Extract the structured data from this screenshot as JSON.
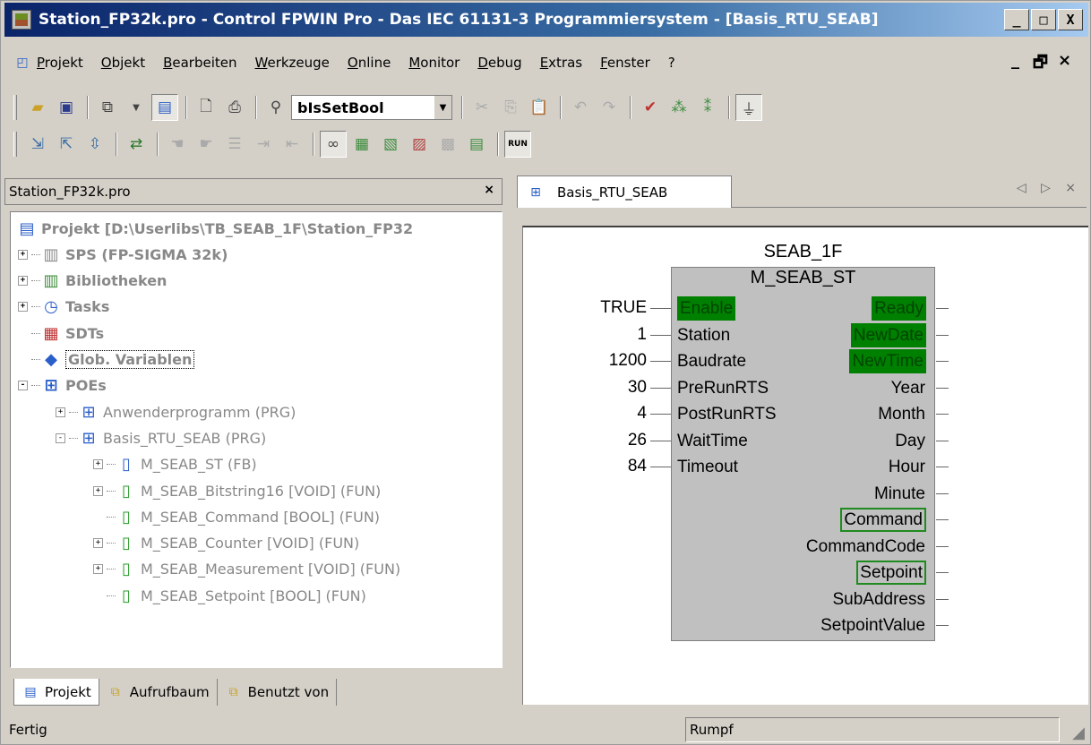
{
  "window": {
    "title": "Station_FP32k.pro - Control FPWIN Pro - Das IEC 61131-3 Programmiersystem - [Basis_RTU_SEAB]",
    "caption_buttons": [
      "_",
      "□",
      "X"
    ]
  },
  "menu": {
    "items": [
      "Projekt",
      "Objekt",
      "Bearbeiten",
      "Werkzeuge",
      "Online",
      "Monitor",
      "Debug",
      "Extras",
      "Fenster",
      "?"
    ],
    "mdi_buttons": [
      "_",
      "🗗",
      "×"
    ]
  },
  "toolbar": {
    "search_combo_value": "bIsSetBool",
    "run_label": "RUN"
  },
  "left_panel": {
    "header": "Station_FP32k.pro",
    "close": "×",
    "tree": [
      {
        "label": "Projekt [D:\\Userlibs\\TB_SEAB_1F\\Station_FP32",
        "level": 0,
        "bold": true,
        "expander": "",
        "icon": "project-icon"
      },
      {
        "label": "SPS (FP-SIGMA 32k)",
        "level": 1,
        "bold": true,
        "expander": "+",
        "icon": "plc-icon"
      },
      {
        "label": "Bibliotheken",
        "level": 1,
        "bold": true,
        "expander": "+",
        "icon": "library-icon"
      },
      {
        "label": "Tasks",
        "level": 1,
        "bold": true,
        "expander": "+",
        "icon": "tasks-icon"
      },
      {
        "label": "SDTs",
        "level": 1,
        "bold": true,
        "expander": "",
        "icon": "sdt-icon"
      },
      {
        "label": "Glob. Variablen",
        "level": 1,
        "bold": true,
        "expander": "",
        "icon": "global-vars-icon"
      },
      {
        "label": "POEs",
        "level": 1,
        "bold": true,
        "expander": "-",
        "icon": "poe-icon"
      },
      {
        "label": "Anwenderprogramm (PRG)",
        "level": 2,
        "bold": false,
        "expander": "+",
        "icon": "program-icon"
      },
      {
        "label": "Basis_RTU_SEAB (PRG)",
        "level": 2,
        "bold": false,
        "expander": "-",
        "icon": "program-icon"
      },
      {
        "label": "M_SEAB_ST (FB)",
        "level": 3,
        "bold": false,
        "expander": "+",
        "icon": "function-block-icon"
      },
      {
        "label": "M_SEAB_Bitstring16 [VOID] (FUN)",
        "level": 3,
        "bold": false,
        "expander": "+",
        "icon": "function-icon"
      },
      {
        "label": "M_SEAB_Command [BOOL] (FUN)",
        "level": 3,
        "bold": false,
        "expander": "",
        "icon": "function-icon"
      },
      {
        "label": "M_SEAB_Counter [VOID] (FUN)",
        "level": 3,
        "bold": false,
        "expander": "+",
        "icon": "function-icon"
      },
      {
        "label": "M_SEAB_Measurement [VOID] (FUN)",
        "level": 3,
        "bold": false,
        "expander": "+",
        "icon": "function-icon"
      },
      {
        "label": "M_SEAB_Setpoint [BOOL] (FUN)",
        "level": 3,
        "bold": false,
        "expander": "",
        "icon": "function-icon"
      }
    ],
    "bottom_tabs": [
      "Projekt",
      "Aufrufbaum",
      "Benutzt von"
    ]
  },
  "editor": {
    "tab_label": "Basis_RTU_SEAB",
    "nav": "◁ ▷ ×",
    "fb_instance": "SEAB_1F",
    "fb_type": "M_SEAB_ST",
    "inputs": [
      {
        "value": "TRUE",
        "pin": "Enable",
        "highlight": true
      },
      {
        "value": "1",
        "pin": "Station",
        "highlight": false
      },
      {
        "value": "1200",
        "pin": "Baudrate",
        "highlight": false
      },
      {
        "value": "30",
        "pin": "PreRunRTS",
        "highlight": false
      },
      {
        "value": "4",
        "pin": "PostRunRTS",
        "highlight": false
      },
      {
        "value": "26",
        "pin": "WaitTime",
        "highlight": false
      },
      {
        "value": "84",
        "pin": "Timeout",
        "highlight": false
      }
    ],
    "outputs": [
      {
        "pin": "Ready",
        "style": "fill"
      },
      {
        "pin": "NewDate",
        "style": "fill"
      },
      {
        "pin": "NewTime",
        "style": "fill"
      },
      {
        "pin": "Year",
        "style": "none"
      },
      {
        "pin": "Month",
        "style": "none"
      },
      {
        "pin": "Day",
        "style": "none"
      },
      {
        "pin": "Hour",
        "style": "none"
      },
      {
        "pin": "Minute",
        "style": "none"
      },
      {
        "pin": "Command",
        "style": "box"
      },
      {
        "pin": "CommandCode",
        "style": "none"
      },
      {
        "pin": "Setpoint",
        "style": "box"
      },
      {
        "pin": "SubAddress",
        "style": "none"
      },
      {
        "pin": "SetpointValue",
        "style": "none"
      }
    ],
    "colors": {
      "active_pin": "#008000",
      "box_pin": "#1f8a1f"
    }
  },
  "status": {
    "left": "Fertig",
    "middle": "Rumpf"
  }
}
